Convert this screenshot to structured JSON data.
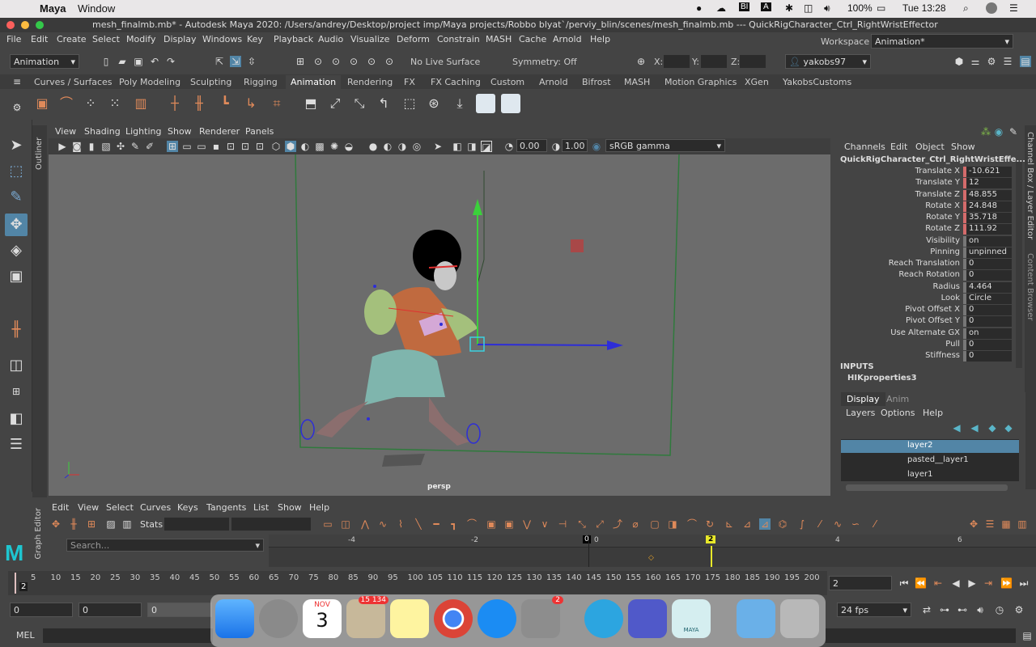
{
  "macmenu": {
    "app": "Maya",
    "window": "Window",
    "battery": "100%",
    "clock": "Tue 13:28",
    "bi": "BI"
  },
  "titlebar": {
    "title": "mesh_finalmb.mb* - Autodesk Maya 2020: /Users/andrey/Desktop/project imp/Maya projects/Robbo blyat`/perviy_blin/scenes/mesh_finalmb.mb   ---   QuickRigCharacter_Ctrl_RightWristEffector"
  },
  "mainmenu": [
    "File",
    "Edit",
    "Create",
    "Select",
    "Modify",
    "Display",
    "Windows",
    "Key",
    "Playback",
    "Audio",
    "Visualize",
    "Deform",
    "Constrain",
    "MASH",
    "Cache",
    "Arnold",
    "Help"
  ],
  "workspace": {
    "label": "Workspace :",
    "value": "Animation*"
  },
  "statusline": {
    "mode": "Animation",
    "live_surface": "No Live Surface",
    "symmetry": "Symmetry: Off",
    "x": "X:",
    "y": "Y:",
    "z": "Z:",
    "user": "yakobs97"
  },
  "shelftabs": [
    "Curves / Surfaces",
    "Poly Modeling",
    "Sculpting",
    "Rigging",
    "Animation",
    "Rendering",
    "FX",
    "FX Caching",
    "Custom",
    "Arnold",
    "Bifrost",
    "MASH",
    "Motion Graphics",
    "XGen",
    "YakobsCustoms"
  ],
  "outliner_tab": "Outliner",
  "viewport": {
    "menu": [
      "View",
      "Shading",
      "Lighting",
      "Show",
      "Renderer",
      "Panels"
    ],
    "exposure": "0.00",
    "gamma": "1.00",
    "colorspace": "sRGB gamma",
    "camera": "persp"
  },
  "channelbox": {
    "menu": [
      "Channels",
      "Edit",
      "Object",
      "Show"
    ],
    "object": "QuickRigCharacter_Ctrl_RightWristEffe...",
    "attrs": [
      {
        "label": "Translate X",
        "value": "-10.621",
        "key": "red"
      },
      {
        "label": "Translate Y",
        "value": "12",
        "key": "red"
      },
      {
        "label": "Translate Z",
        "value": "48.855",
        "key": "red"
      },
      {
        "label": "Rotate X",
        "value": "24.848",
        "key": "red"
      },
      {
        "label": "Rotate Y",
        "value": "35.718",
        "key": "red"
      },
      {
        "label": "Rotate Z",
        "value": "111.92",
        "key": "red"
      },
      {
        "label": "Visibility",
        "value": "on",
        "key": "gray"
      },
      {
        "label": "Pinning",
        "value": "unpinned",
        "key": "gray"
      },
      {
        "label": "Reach Translation",
        "value": "0",
        "key": "gray"
      },
      {
        "label": "Reach Rotation",
        "value": "0",
        "key": "gray"
      },
      {
        "label": "Radius",
        "value": "4.464",
        "key": "gray"
      },
      {
        "label": "Look",
        "value": "Circle",
        "key": "gray"
      },
      {
        "label": "Pivot Offset X",
        "value": "0",
        "key": "gray"
      },
      {
        "label": "Pivot Offset Y",
        "value": "0",
        "key": "gray"
      },
      {
        "label": "Use Alternate GX",
        "value": "on",
        "key": "gray"
      },
      {
        "label": "Pull",
        "value": "0",
        "key": "gray"
      },
      {
        "label": "Stiffness",
        "value": "0",
        "key": "gray"
      }
    ],
    "inputs_label": "INPUTS",
    "input_node": "HIKproperties3"
  },
  "sidetabs": [
    "Channel Box / Layer Editor",
    "Content Browser"
  ],
  "layers": {
    "tabs": [
      "Display",
      "Anim"
    ],
    "menu": [
      "Layers",
      "Options",
      "Help"
    ],
    "items": [
      "layer2",
      "pasted__layer1",
      "layer1"
    ]
  },
  "graph": {
    "menu": [
      "Edit",
      "View",
      "Select",
      "Curves",
      "Keys",
      "Tangents",
      "List",
      "Show",
      "Help"
    ],
    "stats": "Stats",
    "search": "Search...",
    "ruler": [
      "-4",
      "-2",
      "0",
      "0",
      "2",
      "4",
      "6"
    ],
    "current_key": "2",
    "tab": "Graph Editor"
  },
  "timeline": {
    "ticks": [
      "5",
      "10",
      "15",
      "20",
      "25",
      "30",
      "35",
      "40",
      "45",
      "50",
      "55",
      "60",
      "65",
      "70",
      "75",
      "80",
      "85",
      "90",
      "95",
      "100",
      "105",
      "110",
      "115",
      "120",
      "125",
      "130",
      "135",
      "140",
      "145",
      "150",
      "155",
      "160",
      "165",
      "170",
      "175",
      "180",
      "185",
      "190",
      "195",
      "200"
    ],
    "current_frame_left": "2",
    "current_frame": "2"
  },
  "range": {
    "start": "0",
    "start2": "0",
    "anim_start": "0",
    "fps": "24 fps"
  },
  "mel": {
    "label": "MEL"
  },
  "dock": {
    "mail_badge": "15 134",
    "cal_month": "NOV",
    "cal_day": "3",
    "sys_badge": "2",
    "maya_label": "MAYA"
  }
}
